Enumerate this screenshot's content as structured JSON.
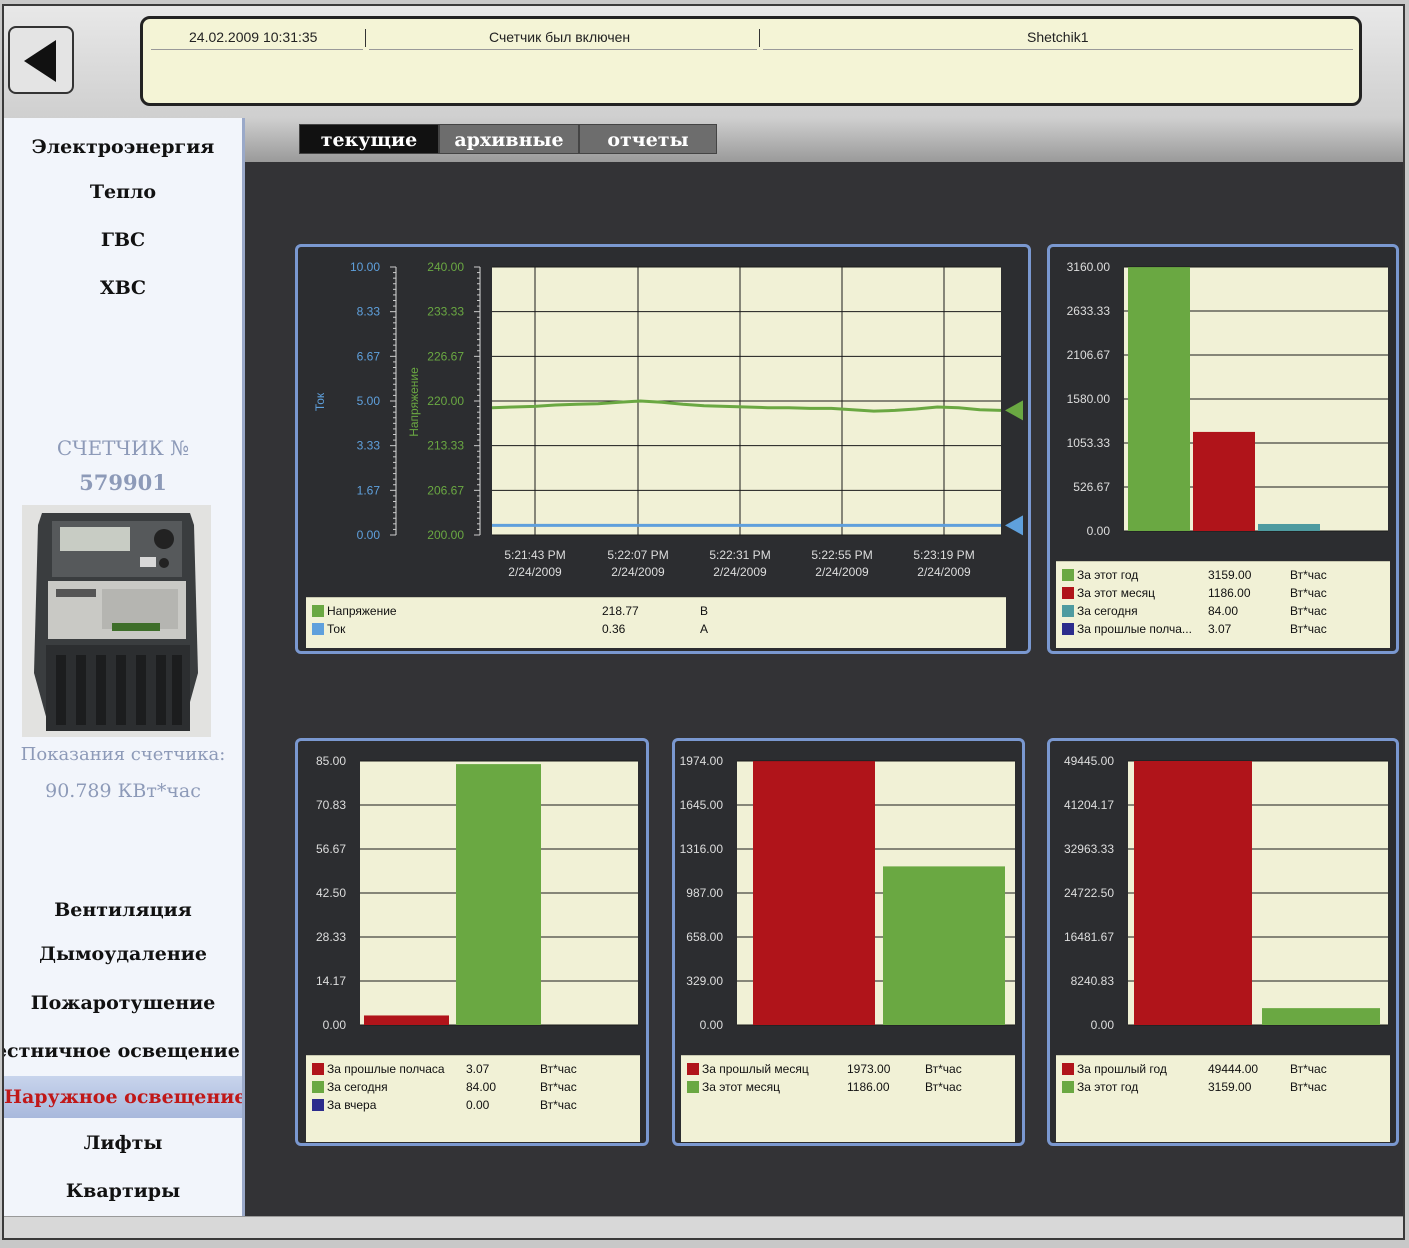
{
  "top_bar": {
    "event_log": {
      "timestamp": "24.02.2009 10:31:35",
      "message": "Счетчик был включен",
      "source": "Shetchik1"
    }
  },
  "sidebar": {
    "top_items": [
      {
        "label": "Электроэнергия",
        "active": true
      },
      {
        "label": "Тепло",
        "active": false
      },
      {
        "label": "ГВС",
        "active": false
      },
      {
        "label": "ХВС",
        "active": false
      }
    ],
    "meter": {
      "title": "СЧЕТЧИК №",
      "number": "579901",
      "reading_label": "Показания счетчика:",
      "reading_value": "90.789 КВт*час"
    },
    "bottom_items": [
      {
        "label": "Вентиляция",
        "active": false
      },
      {
        "label": "Дымоудаление",
        "active": false
      },
      {
        "label": "Пожаротушение",
        "active": false
      },
      {
        "label": "Лестничное освещение",
        "active": false
      },
      {
        "label": "Наружное освещение",
        "active": true
      },
      {
        "label": "Лифты",
        "active": false
      },
      {
        "label": "Квартиры",
        "active": false
      }
    ]
  },
  "tabs": [
    {
      "label": "текущие",
      "active": true
    },
    {
      "label": "архивные",
      "active": false
    },
    {
      "label": "отчеты",
      "active": false
    }
  ],
  "colors": {
    "green": "#6aa842",
    "red": "#b0141a",
    "teal": "#4e9ba0",
    "navy": "#2c2c8c",
    "blue": "#5fa0dc",
    "plot_bg": "#f1f1d6"
  },
  "chart_data": [
    {
      "type": "line",
      "id": "voltage-current",
      "x_ticks": [
        "5:21:43 PM\n2/24/2009",
        "5:22:07 PM\n2/24/2009",
        "5:22:31 PM\n2/24/2009",
        "5:22:55 PM\n2/24/2009",
        "5:23:19 PM\n2/24/2009"
      ],
      "axes": [
        {
          "label": "Ток",
          "ticks": [
            "10.00",
            "8.33",
            "6.67",
            "5.00",
            "3.33",
            "1.67",
            "0.00"
          ],
          "range": [
            0,
            10
          ],
          "color": "#5fa0dc"
        },
        {
          "label": "Напряжение",
          "ticks": [
            "240.00",
            "233.33",
            "226.67",
            "220.00",
            "213.33",
            "206.67",
            "200.00"
          ],
          "range": [
            200,
            240
          ],
          "color": "#6aa842"
        }
      ],
      "series": [
        {
          "name": "Напряжение",
          "axis": 1,
          "color": "#6aa842",
          "value": "218.77",
          "unit": "В",
          "values": [
            219.0,
            219.1,
            219.2,
            219.4,
            219.5,
            219.6,
            219.8,
            220.0,
            219.8,
            219.5,
            219.3,
            219.2,
            219.1,
            219.0,
            219.0,
            218.9,
            218.9,
            218.7,
            218.5,
            218.6,
            218.8,
            219.1,
            219.0,
            218.7,
            218.6
          ]
        },
        {
          "name": "Ток",
          "axis": 0,
          "color": "#5fa0dc",
          "value": "0.36",
          "unit": "А",
          "values": [
            0.36,
            0.36,
            0.36,
            0.36,
            0.36,
            0.36,
            0.36,
            0.36,
            0.36,
            0.36,
            0.36,
            0.36,
            0.36,
            0.36,
            0.36,
            0.36,
            0.36,
            0.36,
            0.36,
            0.36,
            0.36,
            0.36,
            0.36,
            0.36,
            0.36
          ]
        }
      ]
    },
    {
      "type": "bar",
      "id": "summary",
      "ylim": [
        0,
        3160
      ],
      "y_ticks": [
        "3160.00",
        "2633.33",
        "2106.67",
        "1580.00",
        "1053.33",
        "526.67",
        "0.00"
      ],
      "bars": [
        {
          "name": "За этот год",
          "value": 3159.0,
          "label": "3159.00",
          "unit": "Вт*час",
          "color": "#6aa842"
        },
        {
          "name": "За этот месяц",
          "value": 1186.0,
          "label": "1186.00",
          "unit": "Вт*час",
          "color": "#b0141a"
        },
        {
          "name": "За сегодня",
          "value": 84.0,
          "label": "84.00",
          "unit": "Вт*час",
          "color": "#4e9ba0"
        },
        {
          "name": "За прошлые полча...",
          "value": 3.07,
          "label": "3.07",
          "unit": "Вт*час",
          "color": "#2c2c8c"
        }
      ]
    },
    {
      "type": "bar",
      "id": "daily",
      "ylim": [
        0,
        85
      ],
      "y_ticks": [
        "85.00",
        "70.83",
        "56.67",
        "42.50",
        "28.33",
        "14.17",
        "0.00"
      ],
      "bars": [
        {
          "name": "За прошлые полчаса",
          "value": 3.07,
          "label": "3.07",
          "unit": "Вт*час",
          "color": "#b0141a"
        },
        {
          "name": "За сегодня",
          "value": 84.0,
          "label": "84.00",
          "unit": "Вт*час",
          "color": "#6aa842"
        },
        {
          "name": "За вчера",
          "value": 0.0,
          "label": "0.00",
          "unit": "Вт*час",
          "color": "#2c2c8c"
        }
      ]
    },
    {
      "type": "bar",
      "id": "monthly",
      "ylim": [
        0,
        1974
      ],
      "y_ticks": [
        "1974.00",
        "1645.00",
        "1316.00",
        "987.00",
        "658.00",
        "329.00",
        "0.00"
      ],
      "bars": [
        {
          "name": "За прошлый месяц",
          "value": 1973.0,
          "label": "1973.00",
          "unit": "Вт*час",
          "color": "#b0141a"
        },
        {
          "name": "За этот месяц",
          "value": 1186.0,
          "label": "1186.00",
          "unit": "Вт*час",
          "color": "#6aa842"
        }
      ]
    },
    {
      "type": "bar",
      "id": "yearly",
      "ylim": [
        0,
        49445
      ],
      "y_ticks": [
        "49445.00",
        "41204.17",
        "32963.33",
        "24722.50",
        "16481.67",
        "8240.83",
        "0.00"
      ],
      "bars": [
        {
          "name": "За прошлый год",
          "value": 49444.0,
          "label": "49444.00",
          "unit": "Вт*час",
          "color": "#b0141a"
        },
        {
          "name": "За этот год",
          "value": 3159.0,
          "label": "3159.00",
          "unit": "Вт*час",
          "color": "#6aa842"
        }
      ]
    }
  ]
}
